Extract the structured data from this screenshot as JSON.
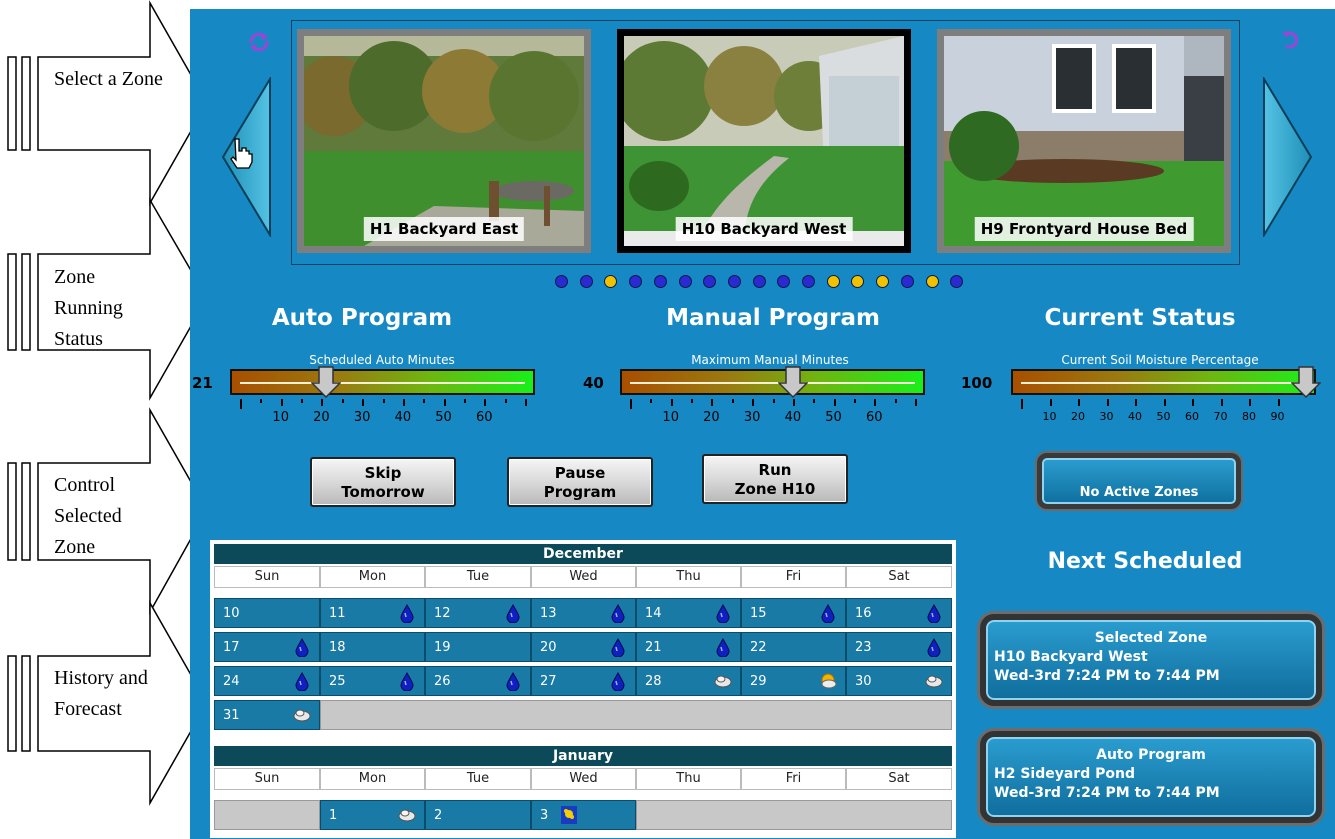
{
  "callouts": [
    "Select a Zone",
    "Zone Running Status",
    "Control Selected Zone",
    "History and Forecast"
  ],
  "zones": [
    {
      "caption": "H1 Backyard East",
      "selected": false
    },
    {
      "caption": "H10 Backyard West",
      "selected": true
    },
    {
      "caption": "H9 Frontyard House Bed",
      "selected": false
    }
  ],
  "dots": [
    "blue",
    "blue",
    "yellow",
    "blue",
    "blue",
    "blue",
    "blue",
    "blue",
    "blue",
    "blue",
    "blue",
    "yellow",
    "yellow",
    "yellow",
    "blue",
    "yellow",
    "blue"
  ],
  "sections": {
    "auto_title": "Auto Program",
    "manual_title": "Manual Program",
    "status_title": "Current Status",
    "next_title": "Next Scheduled"
  },
  "gauges": {
    "auto": {
      "caption": "Scheduled Auto Minutes",
      "value": "21",
      "level": 21,
      "max": 70,
      "ticks": [
        "10",
        "20",
        "30",
        "40",
        "50",
        "60"
      ]
    },
    "manual": {
      "caption": "Maximum Manual Minutes",
      "value": "40",
      "level": 40,
      "max": 70,
      "ticks": [
        "10",
        "20",
        "30",
        "40",
        "50",
        "60"
      ]
    },
    "status": {
      "caption": "Current Soil Moisture Percentage",
      "value": "100",
      "level": 100,
      "max": 100,
      "ticks": [
        "10",
        "20",
        "30",
        "40",
        "50",
        "60",
        "70",
        "80",
        "90"
      ]
    }
  },
  "buttons": {
    "skip": [
      "Skip",
      "Tomorrow"
    ],
    "pause": [
      "Pause",
      "Program"
    ],
    "run": [
      "Run",
      "Zone H10"
    ],
    "status": "No Active Zones"
  },
  "calendar": {
    "weekdays": [
      "Sun",
      "Mon",
      "Tue",
      "Wed",
      "Thu",
      "Fri",
      "Sat"
    ],
    "december": {
      "title": "December",
      "weeks": [
        [
          {
            "d": "10",
            "i": ""
          },
          {
            "d": "11",
            "i": "rain"
          },
          {
            "d": "12",
            "i": "rain"
          },
          {
            "d": "13",
            "i": "rain"
          },
          {
            "d": "14",
            "i": "rain"
          },
          {
            "d": "15",
            "i": "rain"
          },
          {
            "d": "16",
            "i": "rain"
          }
        ],
        [
          {
            "d": "17",
            "i": "rain"
          },
          {
            "d": "18",
            "i": ""
          },
          {
            "d": "19",
            "i": ""
          },
          {
            "d": "20",
            "i": "rain"
          },
          {
            "d": "21",
            "i": "rain"
          },
          {
            "d": "22",
            "i": ""
          },
          {
            "d": "23",
            "i": "rain"
          }
        ],
        [
          {
            "d": "24",
            "i": "rain"
          },
          {
            "d": "25",
            "i": "rain"
          },
          {
            "d": "26",
            "i": "rain"
          },
          {
            "d": "27",
            "i": "rain"
          },
          {
            "d": "28",
            "i": "cloud"
          },
          {
            "d": "29",
            "i": "sun"
          },
          {
            "d": "30",
            "i": "cloud"
          }
        ],
        [
          {
            "d": "31",
            "i": "cloud"
          }
        ]
      ]
    },
    "january": {
      "title": "January",
      "weeks": [
        [
          null,
          {
            "d": "1",
            "i": "cloud"
          },
          {
            "d": "2",
            "i": ""
          },
          {
            "d": "3",
            "i": "flower"
          }
        ]
      ]
    }
  },
  "next": [
    {
      "title": "Selected Zone",
      "zone": "H10 Backyard West",
      "time": "Wed-3rd 7:24 PM to 7:44 PM"
    },
    {
      "title": "Auto Program",
      "zone": "H2 Sideyard Pond",
      "time": "Wed-3rd 7:24 PM to 7:44 PM"
    }
  ],
  "colors": {
    "panel": "#1689c4",
    "dot_blue": "#2a2ad0",
    "dot_yellow": "#f2c200",
    "calendar_header": "#0c4a5a"
  }
}
